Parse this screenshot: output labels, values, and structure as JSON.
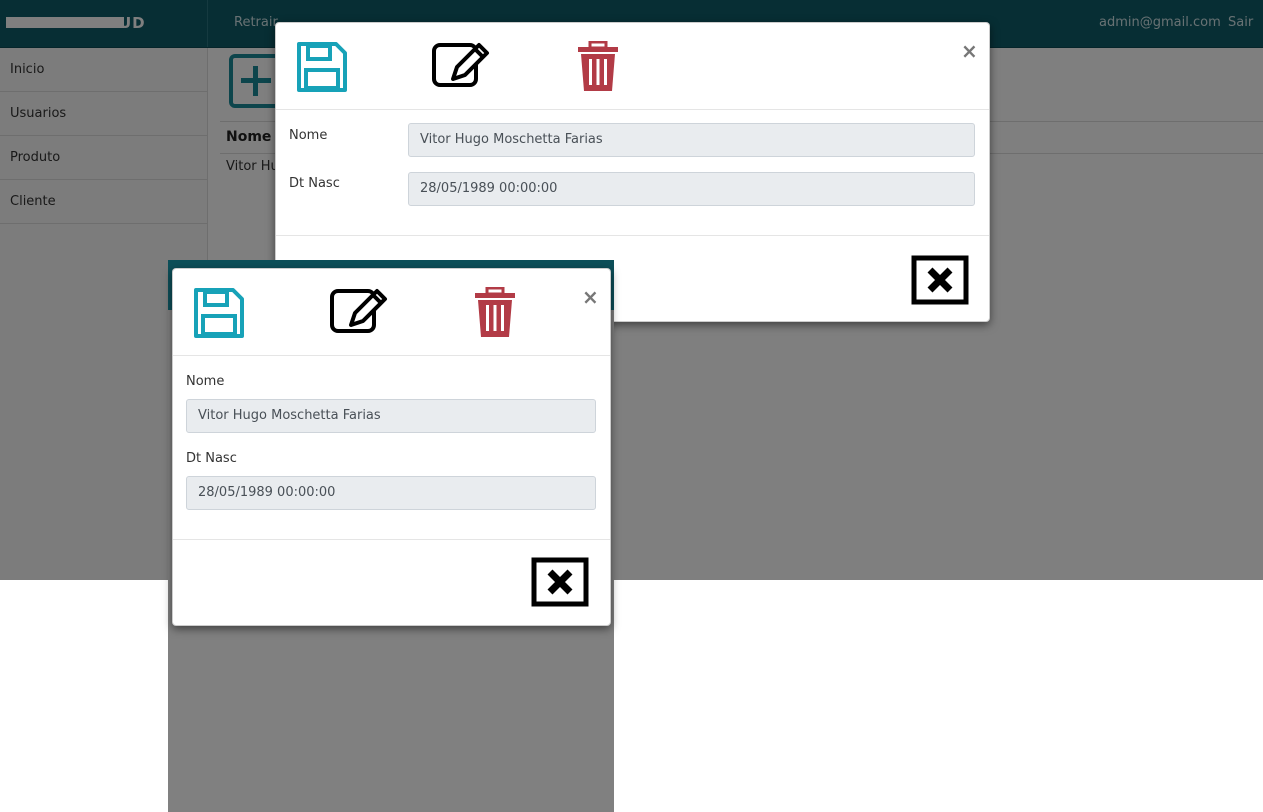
{
  "app": {
    "brand": "SISTEMA CRUD",
    "topnav": [
      "Retrair"
    ],
    "user_email": "admin@gmail.com",
    "logout_label": "Sair"
  },
  "sidebar": {
    "items": [
      {
        "label": "Inicio"
      },
      {
        "label": "Usuarios"
      },
      {
        "label": "Produto"
      },
      {
        "label": "Cliente"
      }
    ]
  },
  "table": {
    "header": "Nome",
    "rows": [
      {
        "nome": "Vitor Hu"
      }
    ]
  },
  "modal_top": {
    "close_symbol": "×",
    "fields": [
      {
        "label": "Nome",
        "value": "Vitor Hugo Moschetta Farias"
      },
      {
        "label": "Dt Nasc",
        "value": "28/05/1989 00:00:00"
      }
    ]
  },
  "modal_bottom": {
    "close_symbol": "×",
    "fields": [
      {
        "label": "Nome",
        "value": "Vitor Hugo Moschetta Farias"
      },
      {
        "label": "Dt Nasc",
        "value": "28/05/1989 00:00:00"
      }
    ]
  },
  "icons": {
    "save": "save-icon",
    "edit": "edit-icon",
    "delete": "trash-icon",
    "close_box": "close-box-icon",
    "add": "plus-icon"
  },
  "colors": {
    "topbar": "#0f5c68",
    "save": "#17a2b8",
    "delete": "#b23b46",
    "edit": "#000000"
  }
}
